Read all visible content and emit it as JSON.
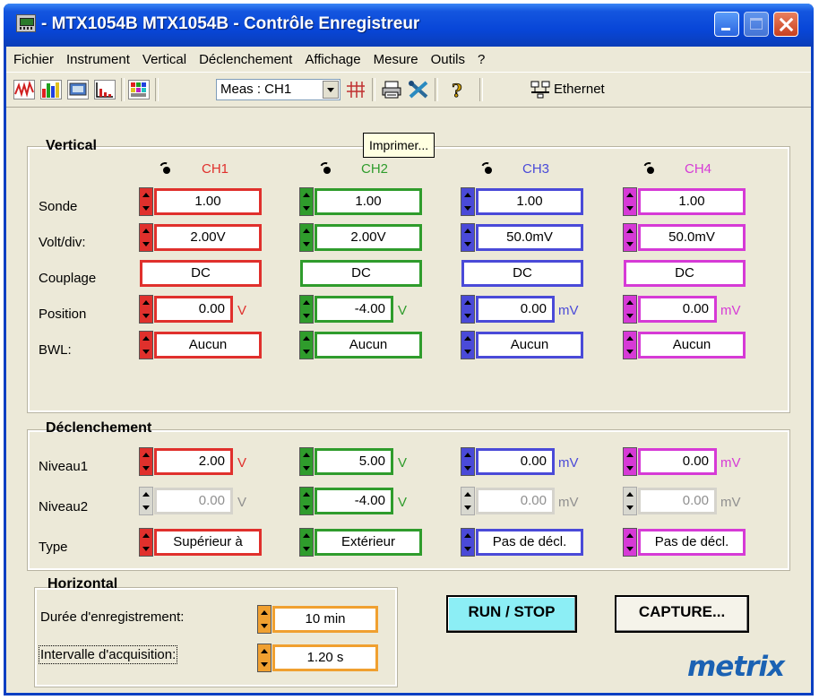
{
  "window": {
    "title": "- MTX1054B MTX1054B - Contrôle Enregistreur"
  },
  "menu": [
    "Fichier",
    "Instrument",
    "Vertical",
    "Déclenchement",
    "Affichage",
    "Mesure",
    "Outils",
    "?"
  ],
  "toolbar": {
    "meas_value": "Meas : CH1",
    "ethernet_label": "Ethernet",
    "tooltip": "Imprimer..."
  },
  "vertical": {
    "title": "Vertical",
    "row_labels": {
      "sonde": "Sonde",
      "voltdiv": "Volt/div:",
      "couplage": "Couplage",
      "position": "Position",
      "bwl": "BWL:"
    },
    "channels": [
      {
        "name": "CH1",
        "color": "#e0302c",
        "sonde": "1.00",
        "voltdiv": "2.00V",
        "couplage": "DC",
        "position": "0.00",
        "position_unit": "V",
        "bwl": "Aucun"
      },
      {
        "name": "CH2",
        "color": "#2f9c2c",
        "sonde": "1.00",
        "voltdiv": "2.00V",
        "couplage": "DC",
        "position": "-4.00",
        "position_unit": "V",
        "bwl": "Aucun"
      },
      {
        "name": "CH3",
        "color": "#4a4ad8",
        "sonde": "1.00",
        "voltdiv": "50.0mV",
        "couplage": "DC",
        "position": "0.00",
        "position_unit": "mV",
        "bwl": "Aucun"
      },
      {
        "name": "CH4",
        "color": "#d63ad6",
        "sonde": "1.00",
        "voltdiv": "50.0mV",
        "couplage": "DC",
        "position": "0.00",
        "position_unit": "mV",
        "bwl": "Aucun"
      }
    ]
  },
  "trigger": {
    "title": "Déclenchement",
    "row_labels": {
      "niveau1": "Niveau1",
      "niveau2": "Niveau2",
      "type": "Type"
    },
    "channels": [
      {
        "niveau1": "2.00",
        "niveau1_unit": "V",
        "niveau2": "0.00",
        "niveau2_unit": "V",
        "type": "Supérieur à"
      },
      {
        "niveau1": "5.00",
        "niveau1_unit": "V",
        "niveau2": "-4.00",
        "niveau2_unit": "V",
        "type": "Extérieur"
      },
      {
        "niveau1": "0.00",
        "niveau1_unit": "mV",
        "niveau2": "0.00",
        "niveau2_unit": "mV",
        "type": "Pas de décl."
      },
      {
        "niveau1": "0.00",
        "niveau1_unit": "mV",
        "niveau2": "0.00",
        "niveau2_unit": "mV",
        "type": "Pas de décl."
      }
    ]
  },
  "horizontal": {
    "title": "Horizontal",
    "duration_label": "Durée d'enregistrement:",
    "duration_value": "10 min",
    "interval_label": "Intervalle d'acquisition:",
    "interval_value": "1.20 s",
    "color": "#f0a030"
  },
  "buttons": {
    "run_stop": "RUN / STOP",
    "capture": "CAPTURE..."
  },
  "logo": "metrix"
}
